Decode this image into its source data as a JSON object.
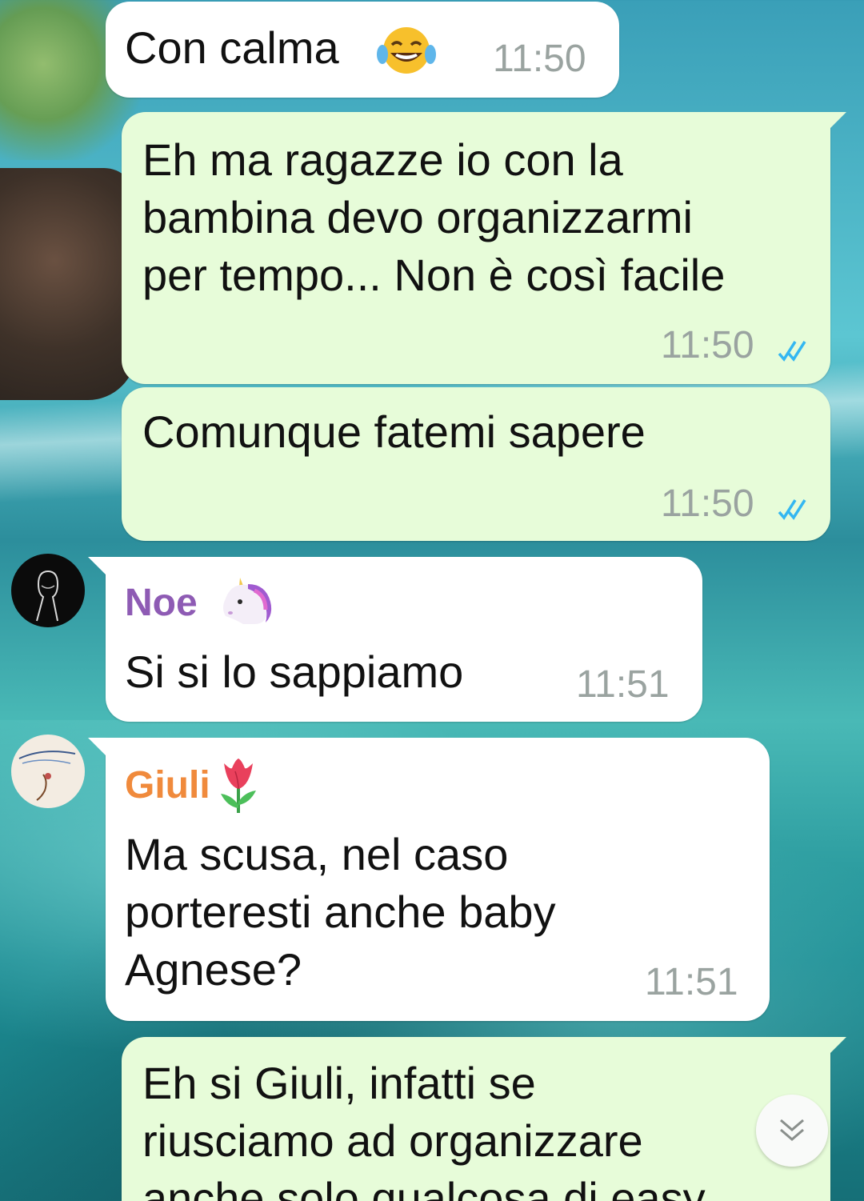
{
  "colors": {
    "incoming_bubble": "#ffffff",
    "outgoing_bubble": "#e7fcd9",
    "timestamp": "#9aa3a0",
    "read_ticks": "#34b7f1",
    "sender_noe": "#8e5bb4",
    "sender_giuli": "#f08a3c"
  },
  "messages": [
    {
      "direction": "incoming",
      "text": "Con calma",
      "emoji": "face-with-tears-of-joy",
      "time": "11:50"
    },
    {
      "direction": "outgoing",
      "lines": [
        "Eh ma ragazze io con la",
        "bambina devo organizzarmi",
        "per tempo... Non è così facile"
      ],
      "time": "11:50",
      "status": "read"
    },
    {
      "direction": "outgoing",
      "text": "Comunque fatemi sapere",
      "time": "11:50",
      "status": "read"
    },
    {
      "direction": "incoming",
      "sender": "Noe",
      "sender_emoji": "unicorn",
      "avatar": "dark-portrait",
      "text": "Si si lo sappiamo",
      "time": "11:51"
    },
    {
      "direction": "incoming",
      "sender": "Giuli",
      "sender_emoji": "tulip",
      "avatar": "sketch-portrait",
      "lines": [
        "Ma scusa, nel caso",
        "porteresti anche baby",
        "Agnese?"
      ],
      "time": "11:51"
    },
    {
      "direction": "outgoing",
      "lines": [
        "Eh si Giuli, infatti se",
        "riusciamo ad organizzare",
        "anche solo qualcosa di easy"
      ]
    }
  ],
  "scroll_button": {
    "icon": "double-chevron-down-icon"
  }
}
